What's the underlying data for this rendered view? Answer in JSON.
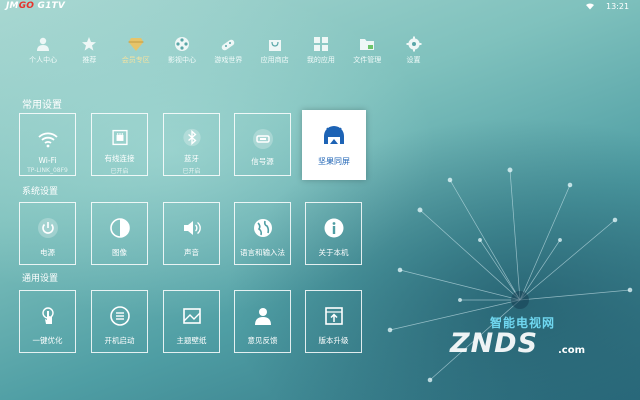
{
  "status_bar": {
    "logo_prefix": "JM",
    "logo_accent": "GO",
    "logo_suffix": " G1TV",
    "time": "13:21"
  },
  "nav": {
    "items": [
      {
        "label": "个人中心",
        "icon": "person-icon"
      },
      {
        "label": "推荐",
        "icon": "star-icon"
      },
      {
        "label": "会员专区",
        "icon": "diamond-icon",
        "active": true
      },
      {
        "label": "影视中心",
        "icon": "film-reel-icon"
      },
      {
        "label": "游戏世界",
        "icon": "gamepad-icon"
      },
      {
        "label": "应用商店",
        "icon": "shopping-bag-icon"
      },
      {
        "label": "我的应用",
        "icon": "apps-grid-icon"
      },
      {
        "label": "文件管理",
        "icon": "folder-icon"
      },
      {
        "label": "设置",
        "icon": "gear-icon"
      }
    ]
  },
  "sections": {
    "common": {
      "title": "常用设置",
      "tiles": [
        {
          "label": "Wi-Fi",
          "sub": "TP-LINK_08F9",
          "icon": "wifi-icon"
        },
        {
          "label": "有线连接",
          "sub": "已开启",
          "icon": "ethernet-icon"
        },
        {
          "label": "蓝牙",
          "sub": "已开启",
          "icon": "bluetooth-icon"
        },
        {
          "label": "信号源",
          "sub": "",
          "icon": "input-source-icon"
        },
        {
          "label": "坚果同屏",
          "sub": "",
          "icon": "screen-mirror-icon",
          "focused": true
        }
      ]
    },
    "system": {
      "title": "系统设置",
      "tiles": [
        {
          "label": "电源",
          "icon": "power-icon"
        },
        {
          "label": "图像",
          "icon": "contrast-icon"
        },
        {
          "label": "声音",
          "icon": "speaker-icon"
        },
        {
          "label": "语言和输入法",
          "icon": "globe-icon"
        },
        {
          "label": "关于本机",
          "icon": "info-icon"
        }
      ]
    },
    "general": {
      "title": "通用设置",
      "tiles": [
        {
          "label": "一键优化",
          "icon": "touch-optimize-icon"
        },
        {
          "label": "开机启动",
          "icon": "startup-list-icon"
        },
        {
          "label": "主题壁纸",
          "icon": "wallpaper-icon"
        },
        {
          "label": "意见反馈",
          "icon": "feedback-person-icon"
        },
        {
          "label": "版本升级",
          "icon": "upgrade-icon"
        }
      ]
    }
  },
  "watermark": {
    "cn": "智能电视网",
    "en": "ZNDS",
    "domain": ".com"
  },
  "colors": {
    "accent_blue": "#1d63b5",
    "active_gold": "#e6c46a",
    "logo_red": "#e8322c"
  }
}
